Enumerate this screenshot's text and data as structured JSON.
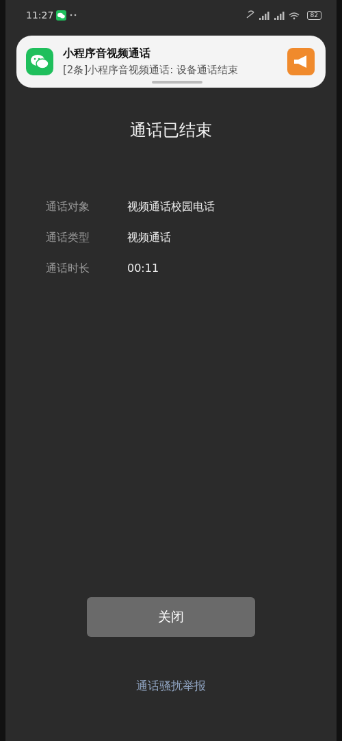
{
  "status_bar": {
    "time": "11:27",
    "battery": "82"
  },
  "notification": {
    "title": "小程序音视频通话",
    "message": "[2条]小程序音视频通话: 设备通话结束"
  },
  "title": "通话已结束",
  "details": [
    {
      "label": "通话对象",
      "value": "视频通话校园电话"
    },
    {
      "label": "通话类型",
      "value": "视频通话"
    },
    {
      "label": "通话时长",
      "value": "00:11"
    }
  ],
  "close_button": "关闭",
  "report_link": "通话骚扰举报"
}
